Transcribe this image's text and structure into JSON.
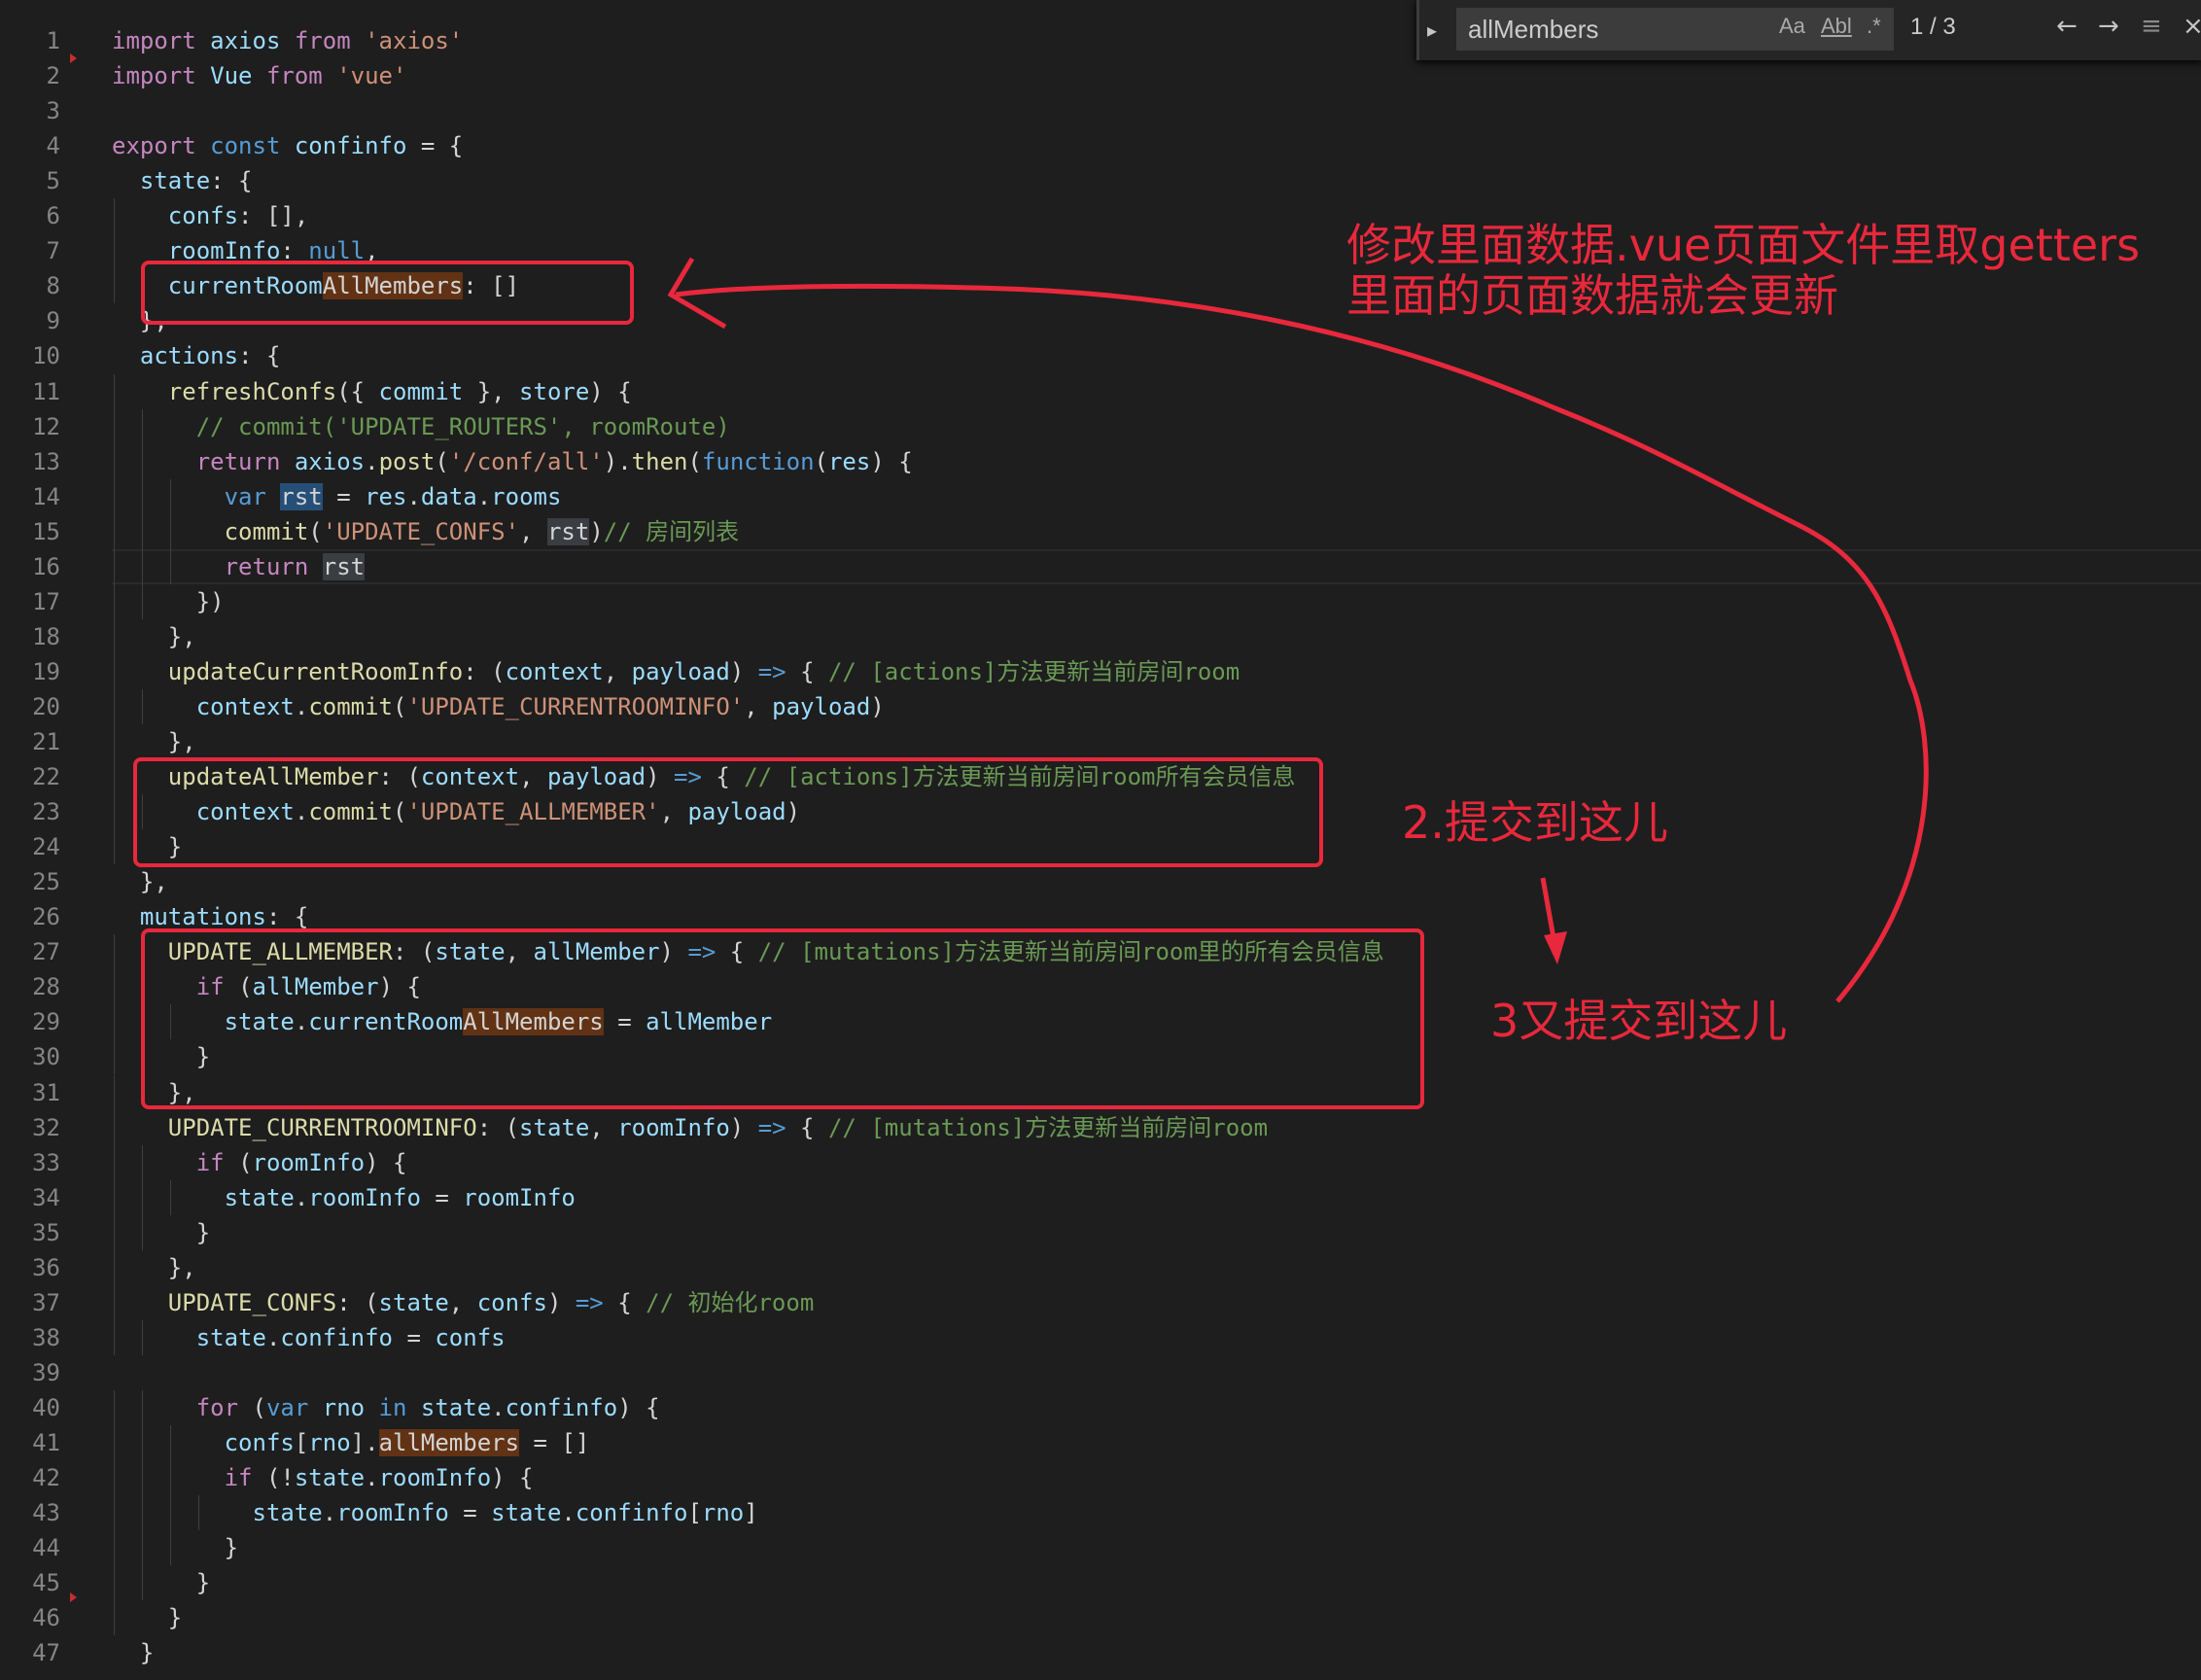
{
  "find": {
    "query": "allMembers",
    "match_case": "Aa",
    "whole_word": "Abl",
    "regex": ".*",
    "count": "1 / 3",
    "prev_icon": "arrow-left-icon",
    "next_icon": "arrow-right-icon",
    "selection_icon": "find-in-selection-icon",
    "close_icon": "close-icon"
  },
  "annotations": {
    "top": "修改里面数据.vue页面文件里取getters\n里面的页面数据就会更新",
    "step2": "2.提交到这儿",
    "step3": "3又提交到这儿"
  },
  "colors": {
    "annotation": "#e8283c",
    "background": "#1e1e1e"
  },
  "lines": [
    {
      "n": "1",
      "t": [
        [
          "kw",
          "import "
        ],
        [
          "vr",
          "axios "
        ],
        [
          "kw",
          "from "
        ],
        [
          "st",
          "'axios'"
        ]
      ]
    },
    {
      "n": "2",
      "t": [
        [
          "kw",
          "import "
        ],
        [
          "vr",
          "Vue "
        ],
        [
          "kw",
          "from "
        ],
        [
          "st",
          "'vue'"
        ]
      ]
    },
    {
      "n": "3",
      "t": []
    },
    {
      "n": "4",
      "t": [
        [
          "kw",
          "export "
        ],
        [
          "kb",
          "const "
        ],
        [
          "vr",
          "confinfo "
        ],
        [
          "tx",
          "= {"
        ]
      ]
    },
    {
      "n": "5",
      "t": [
        [
          "tx",
          "  "
        ],
        [
          "vr",
          "state"
        ],
        [
          "tx",
          ": {"
        ]
      ]
    },
    {
      "n": "6",
      "t": [
        [
          "tx",
          "    "
        ],
        [
          "vr",
          "confs"
        ],
        [
          "tx",
          ": [],"
        ]
      ]
    },
    {
      "n": "7",
      "t": [
        [
          "tx",
          "    "
        ],
        [
          "vr",
          "roomInfo"
        ],
        [
          "tx",
          ": "
        ],
        [
          "kb",
          "null"
        ],
        [
          "tx",
          ","
        ]
      ]
    },
    {
      "n": "8",
      "t": [
        [
          "tx",
          "    "
        ],
        [
          "vr",
          "currentRoom"
        ],
        [
          "hl",
          "AllMembers"
        ],
        [
          "tx",
          ": []"
        ]
      ]
    },
    {
      "n": "9",
      "t": [
        [
          "tx",
          "  },"
        ]
      ]
    },
    {
      "n": "10",
      "t": [
        [
          "tx",
          "  "
        ],
        [
          "vr",
          "actions"
        ],
        [
          "tx",
          ": {"
        ]
      ]
    },
    {
      "n": "11",
      "t": [
        [
          "tx",
          "    "
        ],
        [
          "fn",
          "refreshConfs"
        ],
        [
          "tx",
          "({ "
        ],
        [
          "vr",
          "commit"
        ],
        [
          "tx",
          " }, "
        ],
        [
          "vr",
          "store"
        ],
        [
          "tx",
          ") {"
        ]
      ]
    },
    {
      "n": "12",
      "t": [
        [
          "tx",
          "      "
        ],
        [
          "cm",
          "// commit('UPDATE_ROUTERS', roomRoute)"
        ]
      ]
    },
    {
      "n": "13",
      "t": [
        [
          "tx",
          "      "
        ],
        [
          "kw",
          "return "
        ],
        [
          "vr",
          "axios"
        ],
        [
          "tx",
          "."
        ],
        [
          "fn",
          "post"
        ],
        [
          "tx",
          "("
        ],
        [
          "st",
          "'/conf/all'"
        ],
        [
          "tx",
          ")."
        ],
        [
          "fn",
          "then"
        ],
        [
          "tx",
          "("
        ],
        [
          "kb",
          "function"
        ],
        [
          "tx",
          "("
        ],
        [
          "vr",
          "res"
        ],
        [
          "tx",
          ") {"
        ]
      ]
    },
    {
      "n": "14",
      "t": [
        [
          "tx",
          "        "
        ],
        [
          "kb",
          "var "
        ],
        [
          "hr",
          "rst"
        ],
        [
          "tx",
          " = "
        ],
        [
          "vr",
          "res"
        ],
        [
          "tx",
          "."
        ],
        [
          "vr",
          "data"
        ],
        [
          "tx",
          "."
        ],
        [
          "vr",
          "rooms"
        ]
      ]
    },
    {
      "n": "15",
      "t": [
        [
          "tx",
          "        "
        ],
        [
          "fn",
          "commit"
        ],
        [
          "tx",
          "("
        ],
        [
          "st",
          "'UPDATE_CONFS'"
        ],
        [
          "tx",
          ", "
        ],
        [
          "hs",
          "rst"
        ],
        [
          "tx",
          ")"
        ],
        [
          "cm",
          "// 房间列表"
        ]
      ]
    },
    {
      "n": "16",
      "t": [
        [
          "tx",
          "        "
        ],
        [
          "kw",
          "return "
        ],
        [
          "hs",
          "rst"
        ]
      ]
    },
    {
      "n": "17",
      "t": [
        [
          "tx",
          "      })"
        ]
      ]
    },
    {
      "n": "18",
      "t": [
        [
          "tx",
          "    },"
        ]
      ]
    },
    {
      "n": "19",
      "t": [
        [
          "tx",
          "    "
        ],
        [
          "fn",
          "updateCurrentRoomInfo"
        ],
        [
          "tx",
          ": ("
        ],
        [
          "vr",
          "context"
        ],
        [
          "tx",
          ", "
        ],
        [
          "vr",
          "payload"
        ],
        [
          "tx",
          ") "
        ],
        [
          "kb",
          "=>"
        ],
        [
          "tx",
          " { "
        ],
        [
          "cm",
          "// [actions]方法更新当前房间room"
        ]
      ]
    },
    {
      "n": "20",
      "t": [
        [
          "tx",
          "      "
        ],
        [
          "vr",
          "context"
        ],
        [
          "tx",
          "."
        ],
        [
          "fn",
          "commit"
        ],
        [
          "tx",
          "("
        ],
        [
          "st",
          "'UPDATE_CURRENTROOMINFO'"
        ],
        [
          "tx",
          ", "
        ],
        [
          "vr",
          "payload"
        ],
        [
          "tx",
          ")"
        ]
      ]
    },
    {
      "n": "21",
      "t": [
        [
          "tx",
          "    },"
        ]
      ]
    },
    {
      "n": "22",
      "t": [
        [
          "tx",
          "    "
        ],
        [
          "fn",
          "updateAllMember"
        ],
        [
          "tx",
          ": ("
        ],
        [
          "vr",
          "context"
        ],
        [
          "tx",
          ", "
        ],
        [
          "vr",
          "payload"
        ],
        [
          "tx",
          ") "
        ],
        [
          "kb",
          "=>"
        ],
        [
          "tx",
          " { "
        ],
        [
          "cm",
          "// [actions]方法更新当前房间room所有会员信息"
        ]
      ]
    },
    {
      "n": "23",
      "t": [
        [
          "tx",
          "      "
        ],
        [
          "vr",
          "context"
        ],
        [
          "tx",
          "."
        ],
        [
          "fn",
          "commit"
        ],
        [
          "tx",
          "("
        ],
        [
          "st",
          "'UPDATE_ALLMEMBER'"
        ],
        [
          "tx",
          ", "
        ],
        [
          "vr",
          "payload"
        ],
        [
          "tx",
          ")"
        ]
      ]
    },
    {
      "n": "24",
      "t": [
        [
          "tx",
          "    }"
        ]
      ]
    },
    {
      "n": "25",
      "t": [
        [
          "tx",
          "  },"
        ]
      ]
    },
    {
      "n": "26",
      "t": [
        [
          "tx",
          "  "
        ],
        [
          "vr",
          "mutations"
        ],
        [
          "tx",
          ": {"
        ]
      ]
    },
    {
      "n": "27",
      "t": [
        [
          "tx",
          "    "
        ],
        [
          "fn",
          "UPDATE_ALLMEMBER"
        ],
        [
          "tx",
          ": ("
        ],
        [
          "vr",
          "state"
        ],
        [
          "tx",
          ", "
        ],
        [
          "vr",
          "allMember"
        ],
        [
          "tx",
          ") "
        ],
        [
          "kb",
          "=>"
        ],
        [
          "tx",
          " { "
        ],
        [
          "cm",
          "// [mutations]方法更新当前房间room里的所有会员信息"
        ]
      ]
    },
    {
      "n": "28",
      "t": [
        [
          "tx",
          "      "
        ],
        [
          "kw",
          "if "
        ],
        [
          "tx",
          "("
        ],
        [
          "vr",
          "allMember"
        ],
        [
          "tx",
          ") {"
        ]
      ]
    },
    {
      "n": "29",
      "t": [
        [
          "tx",
          "        "
        ],
        [
          "vr",
          "state"
        ],
        [
          "tx",
          "."
        ],
        [
          "vr",
          "currentRoom"
        ],
        [
          "hl",
          "AllMembers"
        ],
        [
          "tx",
          " = "
        ],
        [
          "vr",
          "allMember"
        ]
      ]
    },
    {
      "n": "30",
      "t": [
        [
          "tx",
          "      }"
        ]
      ]
    },
    {
      "n": "31",
      "t": [
        [
          "tx",
          "    },"
        ]
      ]
    },
    {
      "n": "32",
      "t": [
        [
          "tx",
          "    "
        ],
        [
          "fn",
          "UPDATE_CURRENTROOMINFO"
        ],
        [
          "tx",
          ": ("
        ],
        [
          "vr",
          "state"
        ],
        [
          "tx",
          ", "
        ],
        [
          "vr",
          "roomInfo"
        ],
        [
          "tx",
          ") "
        ],
        [
          "kb",
          "=>"
        ],
        [
          "tx",
          " { "
        ],
        [
          "cm",
          "// [mutations]方法更新当前房间room"
        ]
      ]
    },
    {
      "n": "33",
      "t": [
        [
          "tx",
          "      "
        ],
        [
          "kw",
          "if "
        ],
        [
          "tx",
          "("
        ],
        [
          "vr",
          "roomInfo"
        ],
        [
          "tx",
          ") {"
        ]
      ]
    },
    {
      "n": "34",
      "t": [
        [
          "tx",
          "        "
        ],
        [
          "vr",
          "state"
        ],
        [
          "tx",
          "."
        ],
        [
          "vr",
          "roomInfo"
        ],
        [
          "tx",
          " = "
        ],
        [
          "vr",
          "roomInfo"
        ]
      ]
    },
    {
      "n": "35",
      "t": [
        [
          "tx",
          "      }"
        ]
      ]
    },
    {
      "n": "36",
      "t": [
        [
          "tx",
          "    },"
        ]
      ]
    },
    {
      "n": "37",
      "t": [
        [
          "tx",
          "    "
        ],
        [
          "fn",
          "UPDATE_CONFS"
        ],
        [
          "tx",
          ": ("
        ],
        [
          "vr",
          "state"
        ],
        [
          "tx",
          ", "
        ],
        [
          "vr",
          "confs"
        ],
        [
          "tx",
          ") "
        ],
        [
          "kb",
          "=>"
        ],
        [
          "tx",
          " { "
        ],
        [
          "cm",
          "// 初始化room"
        ]
      ]
    },
    {
      "n": "38",
      "t": [
        [
          "tx",
          "      "
        ],
        [
          "vr",
          "state"
        ],
        [
          "tx",
          "."
        ],
        [
          "vr",
          "confinfo"
        ],
        [
          "tx",
          " = "
        ],
        [
          "vr",
          "confs"
        ]
      ]
    },
    {
      "n": "39",
      "t": []
    },
    {
      "n": "40",
      "t": [
        [
          "tx",
          "      "
        ],
        [
          "kw",
          "for "
        ],
        [
          "tx",
          "("
        ],
        [
          "kb",
          "var "
        ],
        [
          "vr",
          "rno "
        ],
        [
          "kb",
          "in "
        ],
        [
          "vr",
          "state"
        ],
        [
          "tx",
          "."
        ],
        [
          "vr",
          "confinfo"
        ],
        [
          "tx",
          ") {"
        ]
      ]
    },
    {
      "n": "41",
      "t": [
        [
          "tx",
          "        "
        ],
        [
          "vr",
          "confs"
        ],
        [
          "tx",
          "["
        ],
        [
          "vr",
          "rno"
        ],
        [
          "tx",
          "]."
        ],
        [
          "hl",
          "allMembers"
        ],
        [
          "tx",
          " = []"
        ]
      ]
    },
    {
      "n": "42",
      "t": [
        [
          "tx",
          "        "
        ],
        [
          "kw",
          "if "
        ],
        [
          "tx",
          "(!"
        ],
        [
          "vr",
          "state"
        ],
        [
          "tx",
          "."
        ],
        [
          "vr",
          "roomInfo"
        ],
        [
          "tx",
          ") {"
        ]
      ]
    },
    {
      "n": "43",
      "t": [
        [
          "tx",
          "          "
        ],
        [
          "vr",
          "state"
        ],
        [
          "tx",
          "."
        ],
        [
          "vr",
          "roomInfo"
        ],
        [
          "tx",
          " = "
        ],
        [
          "vr",
          "state"
        ],
        [
          "tx",
          "."
        ],
        [
          "vr",
          "confinfo"
        ],
        [
          "tx",
          "["
        ],
        [
          "vr",
          "rno"
        ],
        [
          "tx",
          "]"
        ]
      ]
    },
    {
      "n": "44",
      "t": [
        [
          "tx",
          "        }"
        ]
      ]
    },
    {
      "n": "45",
      "t": [
        [
          "tx",
          "      }"
        ]
      ]
    },
    {
      "n": "46",
      "t": [
        [
          "tx",
          "    }"
        ]
      ]
    },
    {
      "n": "47",
      "t": [
        [
          "tx",
          "  }"
        ]
      ]
    }
  ]
}
